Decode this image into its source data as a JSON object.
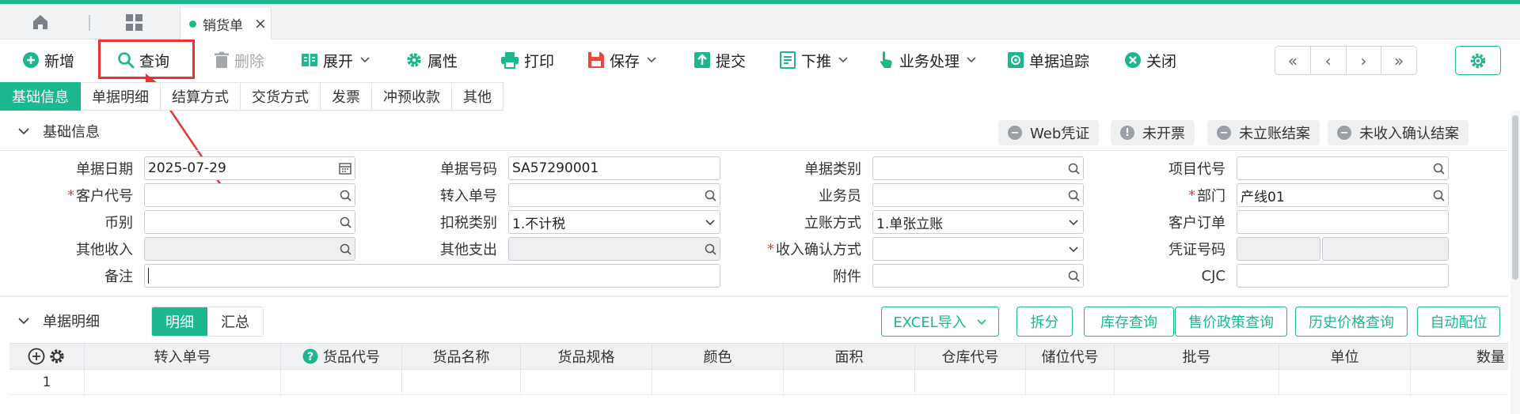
{
  "tabs": {
    "active_label": "销货单",
    "close": "×"
  },
  "toolbar": {
    "new": "新增",
    "query": "查询",
    "delete": "删除",
    "expand": "展开",
    "properties": "属性",
    "print": "打印",
    "save": "保存",
    "submit": "提交",
    "push_down": "下推",
    "business": "业务处理",
    "trace": "单据追踪",
    "close": "关闭"
  },
  "nav": {
    "first": "«",
    "prev": "‹",
    "next": "›",
    "last": "»"
  },
  "subtabs": [
    "基础信息",
    "单据明细",
    "结算方式",
    "交货方式",
    "发票",
    "冲预收款",
    "其他"
  ],
  "basic_section": {
    "title": "基础信息",
    "status_buttons": [
      "Web凭证",
      "未开票",
      "未立账结案",
      "未收入确认结案"
    ]
  },
  "form": {
    "doc_date": {
      "label": "单据日期",
      "value": "2025-07-29"
    },
    "doc_no": {
      "label": "单据号码",
      "value": "SA57290001"
    },
    "doc_type": {
      "label": "单据类别",
      "value": ""
    },
    "project_code": {
      "label": "项目代号",
      "value": ""
    },
    "customer_code": {
      "label": "客户代号",
      "value": "",
      "required": "*"
    },
    "transfer_no": {
      "label": "转入单号",
      "value": ""
    },
    "salesperson": {
      "label": "业务员",
      "value": ""
    },
    "department": {
      "label": "部门",
      "value": "产线01",
      "required": "*"
    },
    "currency": {
      "label": "币别",
      "value": ""
    },
    "tax_type": {
      "label": "扣税类别",
      "value": "1.不计税"
    },
    "account_method": {
      "label": "立账方式",
      "value": "1.单张立账"
    },
    "customer_order": {
      "label": "客户订单",
      "value": ""
    },
    "other_income": {
      "label": "其他收入",
      "value": ""
    },
    "other_expense": {
      "label": "其他支出",
      "value": ""
    },
    "revenue_method": {
      "label": "收入确认方式",
      "value": "",
      "required": "*"
    },
    "voucher_no": {
      "label": "凭证号码",
      "value": ""
    },
    "remark": {
      "label": "备注",
      "value": ""
    },
    "attachment": {
      "label": "附件",
      "value": ""
    },
    "cjc": {
      "label": "CJC",
      "value": ""
    }
  },
  "detail_section": {
    "title": "单据明细",
    "segments": [
      "明细",
      "汇总"
    ],
    "buttons": [
      "EXCEL导入",
      "拆分",
      "库存查询",
      "售价政策查询",
      "历史价格查询",
      "自动配位"
    ]
  },
  "table": {
    "columns": [
      "转入单号",
      "货品代号",
      "货品名称",
      "货品规格",
      "颜色",
      "面积",
      "仓库代号",
      "储位代号",
      "批号",
      "单位",
      "数量"
    ],
    "rows": [
      {
        "index": "1"
      }
    ]
  },
  "colors": {
    "accent": "#1cb78e",
    "highlight": "#e63333",
    "required": "#e23c3c"
  }
}
